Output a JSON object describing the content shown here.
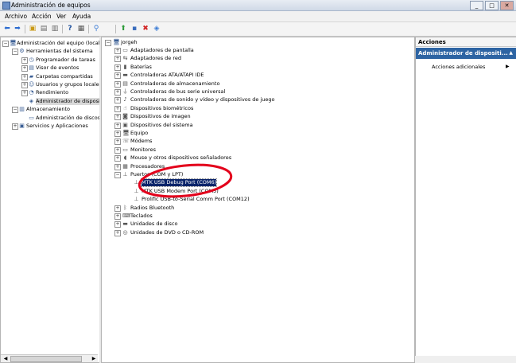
{
  "window": {
    "title": "Administración de equipos",
    "min": "_",
    "max": "□",
    "close": "✕"
  },
  "menu": [
    "Archivo",
    "Acción",
    "Ver",
    "Ayuda"
  ],
  "toolbar_icons": [
    "back-icon",
    "forward-icon",
    "up-icon",
    "properties-icon",
    "hide-tree-icon",
    "help-icon",
    "export-icon",
    "scan-icon",
    "update-driver-icon",
    "disable-icon",
    "uninstall-icon"
  ],
  "left_tree": [
    {
      "label": "Administración del equipo (local)",
      "icon": "computer-icon",
      "level": 0,
      "expander": "⊟"
    },
    {
      "label": "Herramientas del sistema",
      "icon": "tools-icon",
      "level": 1,
      "expander": "⊟"
    },
    {
      "label": "Programador de tareas",
      "icon": "clock-icon",
      "level": 2,
      "expander": "+"
    },
    {
      "label": "Visor de eventos",
      "icon": "event-icon",
      "level": 2,
      "expander": "+"
    },
    {
      "label": "Carpetas compartidas",
      "icon": "folder-icon",
      "level": 2,
      "expander": "+"
    },
    {
      "label": "Usuarios y grupos locales",
      "icon": "users-icon",
      "level": 2,
      "expander": "+"
    },
    {
      "label": "Rendimiento",
      "icon": "perf-icon",
      "level": 2,
      "expander": "+"
    },
    {
      "label": "Administrador de dispositi",
      "icon": "devmgr-icon",
      "level": 2,
      "expander": "",
      "selected": true
    },
    {
      "label": "Almacenamiento",
      "icon": "storage-icon",
      "level": 1,
      "expander": "⊟"
    },
    {
      "label": "Administración de discos",
      "icon": "disk-icon",
      "level": 2,
      "expander": ""
    },
    {
      "label": "Servicios y Aplicaciones",
      "icon": "services-icon",
      "level": 1,
      "expander": "+"
    }
  ],
  "device_tree": {
    "root": "jorgeh",
    "items": [
      {
        "label": "Adaptadores de pantalla",
        "level": 1,
        "expander": "+",
        "icon": "display-icon"
      },
      {
        "label": "Adaptadores de red",
        "level": 1,
        "expander": "+",
        "icon": "network-icon"
      },
      {
        "label": "Baterías",
        "level": 1,
        "expander": "+",
        "icon": "battery-icon"
      },
      {
        "label": "Controladoras ATA/ATAPI IDE",
        "level": 1,
        "expander": "+",
        "icon": "ide-icon"
      },
      {
        "label": "Controladoras de almacenamiento",
        "level": 1,
        "expander": "+",
        "icon": "storage-ctrl-icon"
      },
      {
        "label": "Controladoras de bus serie universal",
        "level": 1,
        "expander": "+",
        "icon": "usb-icon"
      },
      {
        "label": "Controladoras de sonido y vídeo y dispositivos de juego",
        "level": 1,
        "expander": "+",
        "icon": "sound-icon"
      },
      {
        "label": "Dispositivos biométricos",
        "level": 1,
        "expander": "+",
        "icon": "biometric-icon"
      },
      {
        "label": "Dispositivos de imagen",
        "level": 1,
        "expander": "+",
        "icon": "camera-icon"
      },
      {
        "label": "Dispositivos del sistema",
        "level": 1,
        "expander": "+",
        "icon": "system-icon"
      },
      {
        "label": "Equipo",
        "level": 1,
        "expander": "+",
        "icon": "computer-icon"
      },
      {
        "label": "Módems",
        "level": 1,
        "expander": "+",
        "icon": "modem-icon"
      },
      {
        "label": "Monitores",
        "level": 1,
        "expander": "+",
        "icon": "monitor-icon"
      },
      {
        "label": "Mouse y otros dispositivos señaladores",
        "level": 1,
        "expander": "+",
        "icon": "mouse-icon"
      },
      {
        "label": "Procesadores",
        "level": 1,
        "expander": "+",
        "icon": "cpu-icon"
      },
      {
        "label": "Puertos (COM y LPT)",
        "level": 1,
        "expander": "⊟",
        "icon": "port-icon"
      },
      {
        "label": "MTK USB Debug Port (COM6)",
        "level": 2,
        "expander": "",
        "icon": "port-device-icon",
        "selected": true
      },
      {
        "label": "MTK USB Modem Port (COM5)",
        "level": 2,
        "expander": "",
        "icon": "port-device-icon"
      },
      {
        "label": "Prolific USB-to-Serial Comm Port (COM12)",
        "level": 2,
        "expander": "",
        "icon": "port-device-icon"
      },
      {
        "label": "Radios Bluetooth",
        "level": 1,
        "expander": "+",
        "icon": "bluetooth-icon"
      },
      {
        "label": "Teclados",
        "level": 1,
        "expander": "+",
        "icon": "keyboard-icon"
      },
      {
        "label": "Unidades de disco",
        "level": 1,
        "expander": "+",
        "icon": "disk-drive-icon"
      },
      {
        "label": "Unidades de DVD o CD-ROM",
        "level": 1,
        "expander": "+",
        "icon": "dvd-icon"
      }
    ]
  },
  "actions": {
    "header": "Acciones",
    "selected": "Administrador de dispositi...",
    "item": "Acciones adicionales",
    "item_arrow": "▶",
    "collapse": "▲"
  },
  "colors": {
    "highlight_circle": "#e3001b",
    "actions_selected": "#2d64a3",
    "selection": "#0a246a"
  }
}
